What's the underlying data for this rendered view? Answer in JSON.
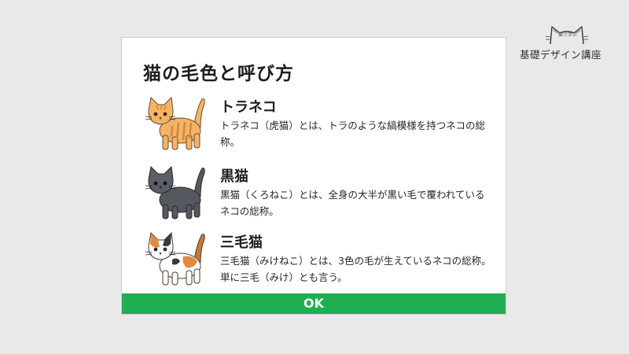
{
  "logo": {
    "small_text": "猫で学ぶ",
    "main_text": "基礎デザイン講座"
  },
  "dialog": {
    "title": "猫の毛色と呼び方",
    "entries": [
      {
        "name": "トラネコ",
        "description": "トラネコ（虎猫）とは、トラのような縞模様を持つネコの総称。",
        "icon": "orange-tabby-cat-icon"
      },
      {
        "name": "黒猫",
        "description": "黒猫（くろねこ）とは、全身の大半が黒い毛で覆われているネコの総称。",
        "icon": "black-cat-icon"
      },
      {
        "name": "三毛猫",
        "description": "三毛猫（みけねこ）とは、3色の毛が生えているネコの総称。単に三毛（みけ）とも言う。",
        "icon": "calico-cat-icon"
      }
    ],
    "ok_label": "OK"
  },
  "colors": {
    "ok_button": "#1fae52",
    "background": "#e9e9e9",
    "tabby": "#f2b467",
    "black_cat": "#55585f"
  }
}
